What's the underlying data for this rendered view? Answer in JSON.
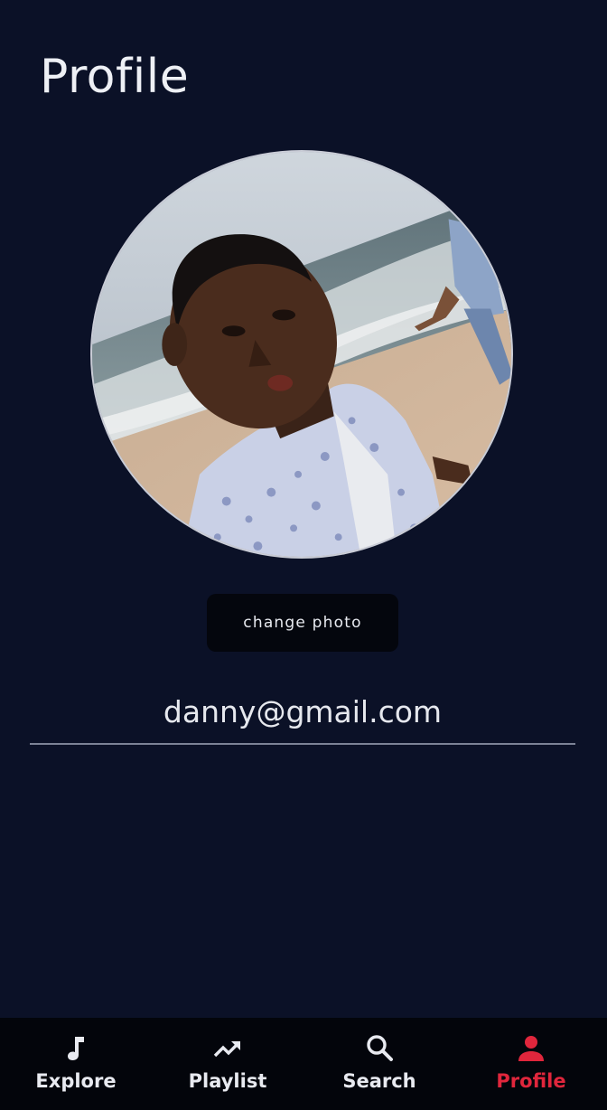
{
  "page": {
    "title": "Profile"
  },
  "profile": {
    "change_photo_label": "change photo",
    "email": "danny@gmail.com"
  },
  "bottom_nav": {
    "items": [
      {
        "label": "Explore",
        "icon": "music-note-icon",
        "active": false
      },
      {
        "label": "Playlist",
        "icon": "trending-up-icon",
        "active": false
      },
      {
        "label": "Search",
        "icon": "search-icon",
        "active": false
      },
      {
        "label": "Profile",
        "icon": "person-icon",
        "active": true
      }
    ]
  },
  "colors": {
    "background": "#0b1127",
    "nav_background": "#03050b",
    "accent": "#e0263c",
    "text": "#e6e8ee",
    "button_background": "#04060d"
  }
}
